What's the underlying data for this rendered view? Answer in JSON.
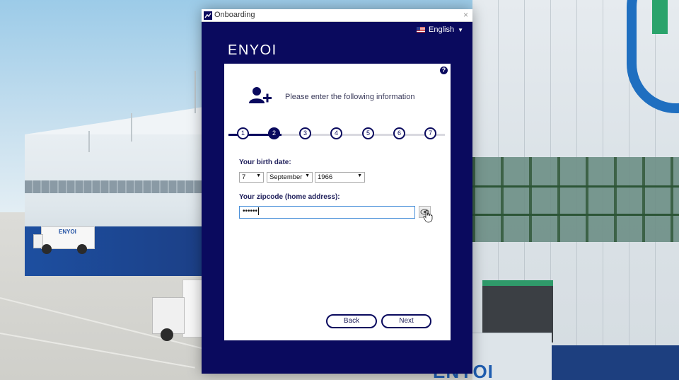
{
  "window": {
    "title": "Onboarding",
    "close_glyph": "×",
    "language": "English",
    "brand": "ENYOI"
  },
  "panel": {
    "headline": "Please enter the following information",
    "help_glyph": "?",
    "steps": [
      "1",
      "2",
      "3",
      "4",
      "5",
      "6",
      "7"
    ],
    "active_step": 2,
    "birth_date_label": "Your birth date:",
    "birth_day": "7",
    "birth_month": "September",
    "birth_year": "1966",
    "zip_label": "Your zipcode (home address):",
    "zip_value": "••••••",
    "back_label": "Back",
    "next_label": "Next"
  },
  "background": {
    "truck_brand": "ENYOI",
    "trailer_brand": "ENYOI"
  },
  "colors": {
    "accent": "#0a0a5e",
    "panel": "#ffffff",
    "input_focus": "#4a90d9"
  },
  "icons": [
    "app-icon",
    "close-icon",
    "us-flag-icon",
    "chevron-down-icon",
    "help-icon",
    "user-add-icon",
    "eye-icon",
    "hand-cursor-icon"
  ]
}
